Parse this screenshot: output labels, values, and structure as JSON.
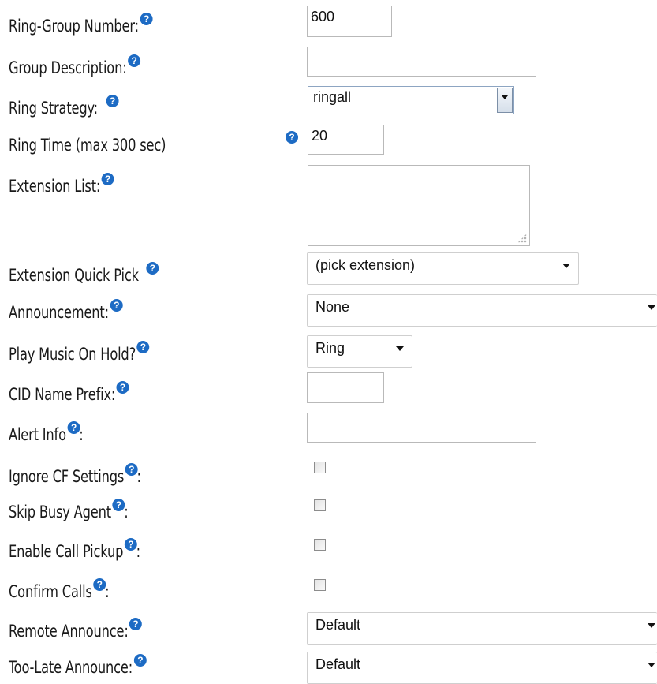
{
  "help_glyph": "?",
  "rows": {
    "ring_group_number": {
      "label": "Ring-Group Number:",
      "value": "600"
    },
    "group_description": {
      "label": "Group Description:",
      "value": ""
    },
    "ring_strategy": {
      "label": "Ring Strategy:",
      "value": "ringall"
    },
    "ring_time": {
      "label": "Ring Time (max 300 sec)",
      "value": "20"
    },
    "extension_list": {
      "label": "Extension List:",
      "value": ""
    },
    "extension_quick_pick": {
      "label": "Extension Quick Pick",
      "value": "(pick extension)"
    },
    "announcement": {
      "label": "Announcement:",
      "value": "None"
    },
    "play_music_on_hold": {
      "label": "Play Music On Hold?",
      "value": "Ring"
    },
    "cid_name_prefix": {
      "label": "CID Name Prefix:",
      "value": ""
    },
    "alert_info": {
      "label": "Alert Info",
      "suffix": ":",
      "value": ""
    },
    "ignore_cf_settings": {
      "label": "Ignore CF Settings",
      "suffix": ":",
      "checked": false
    },
    "skip_busy_agent": {
      "label": "Skip Busy Agent",
      "suffix": ":",
      "checked": false
    },
    "enable_call_pickup": {
      "label": "Enable Call Pickup",
      "suffix": ":",
      "checked": false
    },
    "confirm_calls": {
      "label": "Confirm Calls",
      "suffix": ":",
      "checked": false
    },
    "remote_announce": {
      "label": "Remote Announce:",
      "value": "Default"
    },
    "too_late_announce": {
      "label": "Too-Late Announce:",
      "value": "Default"
    }
  },
  "colors": {
    "help_icon": "#1d6bc4",
    "field_border": "#b9b9b9",
    "text": "#1a1a1a"
  }
}
